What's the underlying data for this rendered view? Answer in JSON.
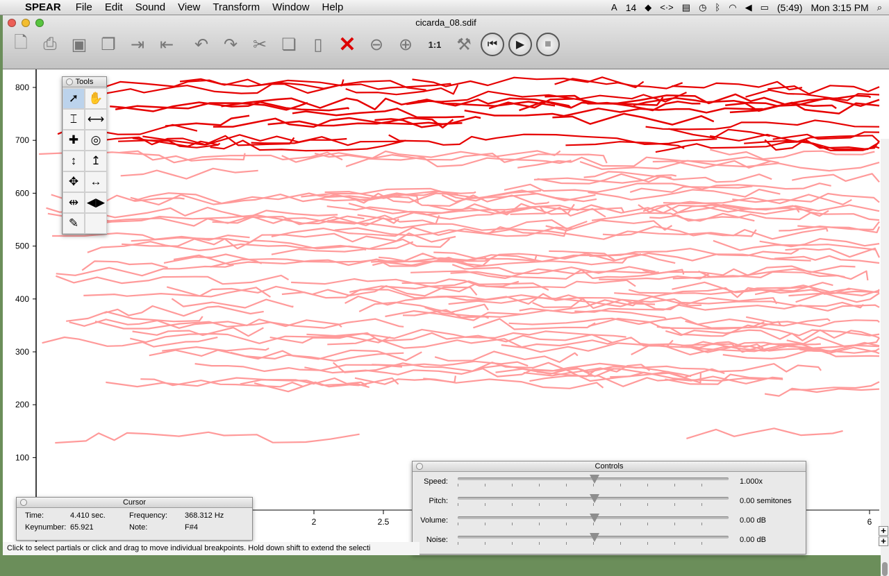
{
  "menubar": {
    "app": "SPEAR",
    "items": [
      "File",
      "Edit",
      "Sound",
      "View",
      "Transform",
      "Window",
      "Help"
    ],
    "status": {
      "adobe_count": "14",
      "battery": "(5:49)",
      "clock": "Mon 3:15 PM"
    }
  },
  "window": {
    "title": "cicarda_08.sdif"
  },
  "toolbar": {
    "icons": [
      "new-file-icon",
      "print-icon",
      "save-icon",
      "open-recent-icon",
      "import-icon",
      "export-icon",
      "undo-icon",
      "redo-icon",
      "cut-icon",
      "copy-icon",
      "paste-icon",
      "delete-icon",
      "zoom-out-icon",
      "zoom-in-icon",
      "zoom-actual-icon",
      "tools-icon",
      "rewind-icon",
      "play-icon",
      "stop-icon"
    ]
  },
  "plot": {
    "y_ticks": [
      "800",
      "700",
      "600",
      "500",
      "400",
      "300",
      "200",
      "100"
    ],
    "x_ticks": [
      "2",
      "2.5",
      "6"
    ],
    "partial_color": "#ff9a9a",
    "selected_color": "#e60000"
  },
  "tools_panel": {
    "title": "Tools",
    "tools": [
      "arrow-tool-icon",
      "hand-tool-icon",
      "time-select-icon",
      "frequency-select-icon",
      "crosshair-icon",
      "lasso-icon",
      "vertical-move-icon",
      "vertical-move-up-icon",
      "move-all-icon",
      "horizontal-move-icon",
      "time-stretch-icon",
      "time-flip-icon",
      "pencil-icon"
    ]
  },
  "cursor_panel": {
    "title": "Cursor",
    "time_label": "Time:",
    "time_value": "4.410 sec.",
    "frequency_label": "Frequency:",
    "frequency_value": "368.312 Hz",
    "keynumber_label": "Keynumber:",
    "keynumber_value": "65.921",
    "note_label": "Note:",
    "note_value": "F#4"
  },
  "controls_panel": {
    "title": "Controls",
    "rows": [
      {
        "label": "Speed:",
        "value": "1.000x",
        "level": 0.5
      },
      {
        "label": "Pitch:",
        "value": "0.00 semitones",
        "level": 0.5
      },
      {
        "label": "Volume:",
        "value": "0.00 dB",
        "level": 0.5
      },
      {
        "label": "Noise:",
        "value": "0.00 dB",
        "level": 0.5
      }
    ]
  },
  "status": {
    "text": "Click to select partials or click and drag to move individual breakpoints. Hold down shift to extend the selecti"
  }
}
